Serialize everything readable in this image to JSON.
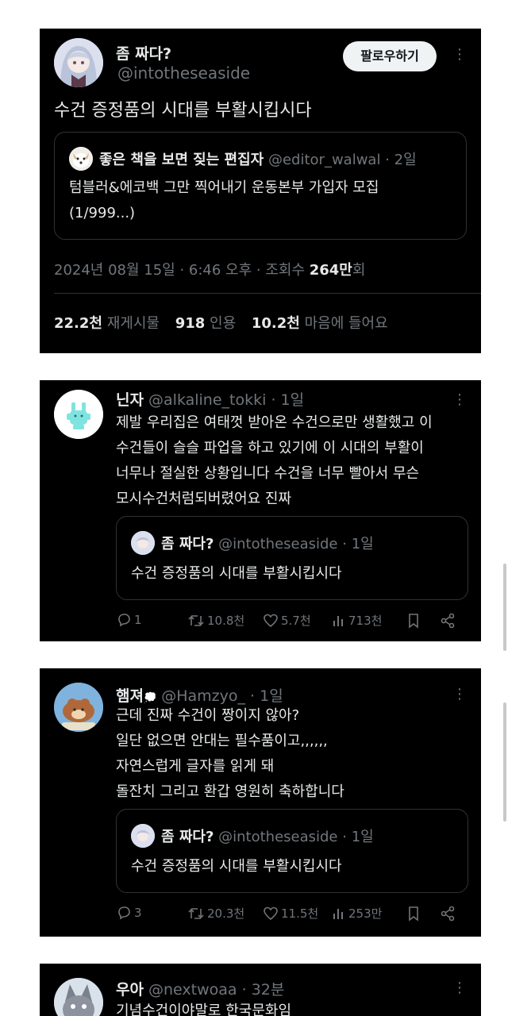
{
  "main_tweet": {
    "display_name": "좀 짜다?",
    "handle": "@intotheseaside",
    "follow_label": "팔로우하기",
    "text": "수건 증정품의 시대를 부활시킵시다",
    "quote": {
      "display_name": "좋은 책을 보면 짖는 편집자",
      "handle": "@editor_walwal",
      "time": "· 2일",
      "text_line1": "텀블러&에코백 그만 찍어내기 운동본부 가입자 모집",
      "text_line2": "(1/999...)"
    },
    "meta_prefix": "2024년 08월 15일 · 6:46 오후 · 조회수 ",
    "views": "264만",
    "views_suffix": "회",
    "stats": {
      "retweets": "22.2천",
      "retweets_label": "재게시물",
      "quotes": "918",
      "quotes_label": "인용",
      "likes": "10.2천",
      "likes_label": "마음에 들어요"
    }
  },
  "replies": [
    {
      "display_name": "닌자",
      "handle": "@alkaline_tokki",
      "time": "· 1일",
      "lines": [
        "제발 우리집은 여태껏 받아온 수건으로만 생활했고 이",
        "수건들이 슬슬 파업을 하고 있기에 이 시대의 부활이",
        "너무나 절실한 상황입니다 수건을 너무 빨아서 무슨",
        "모시수건처럼되버렸어요 진짜"
      ],
      "quote": {
        "display_name": "좀 짜다?",
        "handle": "@intotheseaside",
        "time": "· 1일",
        "text": "수건 증정품의 시대를 부활시킵시다"
      },
      "stats": {
        "replies": "1",
        "retweets": "10.8천",
        "likes": "5.7천",
        "views": "713천"
      }
    },
    {
      "display_name": "햄져",
      "handle": "@Hamzyo_",
      "time": "· 1일",
      "lines": [
        "근데 진짜 수건이 짱이지 않아?",
        "일단 없으면 안대는 필수품이고,,,,,,",
        "자연스럽게 글자를 읽게 돼",
        "돌잔치 그리고 환갑 영원히 축하합니다"
      ],
      "quote": {
        "display_name": "좀 짜다?",
        "handle": "@intotheseaside",
        "time": "· 1일",
        "text": "수건 증정품의 시대를 부활시킵시다"
      },
      "stats": {
        "replies": "3",
        "retweets": "20.3천",
        "likes": "11.5천",
        "views": "253만"
      }
    },
    {
      "display_name": "우아",
      "handle": "@nextwoaa",
      "time": "· 32분",
      "lines": [
        "기념수건이야말로 한국문화임"
      ]
    }
  ],
  "icons": {
    "more": "more-icon",
    "reply": "reply-icon",
    "retweet": "retweet-icon",
    "like": "heart-icon",
    "views": "views-icon",
    "bookmark": "bookmark-icon",
    "share": "share-icon"
  },
  "colors": {
    "background": "#000000",
    "text": "#e7e9ea",
    "muted": "#71767b",
    "border": "#2f3336"
  }
}
